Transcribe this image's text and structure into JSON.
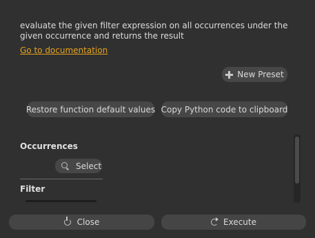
{
  "description": {
    "text": "evaluate the given filter expression on all occurrences under the given occurrence and returns the result"
  },
  "links": {
    "documentation": "Go to documentation"
  },
  "presets": {
    "new_label": "New Preset",
    "icon": "plus-icon"
  },
  "actions": {
    "restore_label": "Restore function default values",
    "copy_label": "Copy Python code to clipboard"
  },
  "sections": {
    "occurrences": {
      "title": "Occurrences",
      "select_label": "Select",
      "select_icon": "search-icon"
    },
    "filter": {
      "title": "Filter"
    }
  },
  "footer": {
    "close_label": "Close",
    "close_icon": "power-icon",
    "execute_label": "Execute",
    "execute_icon": "refresh-icon"
  },
  "colors": {
    "background": "#303030",
    "button": "#474747",
    "link": "#e5a41d",
    "text": "#dcdcdc"
  }
}
